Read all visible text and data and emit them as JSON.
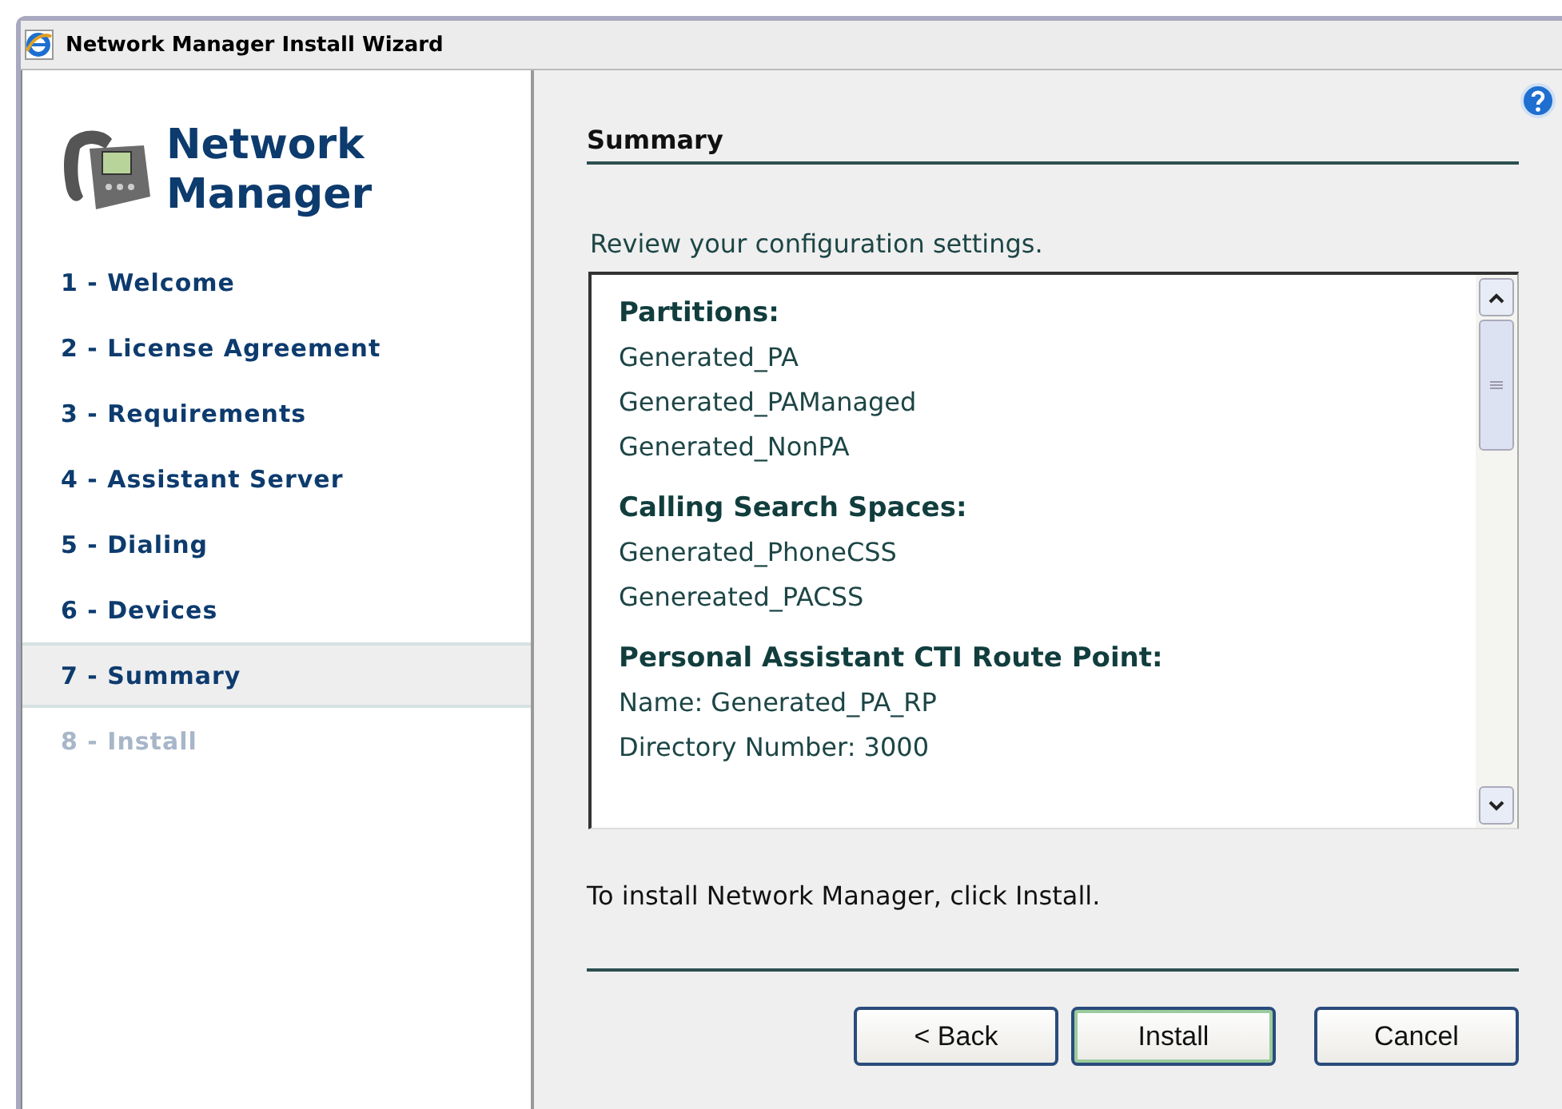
{
  "window": {
    "title": "Network Manager Install Wizard"
  },
  "logo": {
    "line_1": "Network",
    "line_2": "Manager"
  },
  "steps": [
    {
      "label": "1 - Welcome",
      "selected": false,
      "disabled": false
    },
    {
      "label": "2 - License Agreement",
      "selected": false,
      "disabled": false
    },
    {
      "label": "3 - Requirements",
      "selected": false,
      "disabled": false
    },
    {
      "label": "4 - Assistant Server",
      "selected": false,
      "disabled": false
    },
    {
      "label": "5 - Dialing",
      "selected": false,
      "disabled": false
    },
    {
      "label": "6 - Devices",
      "selected": false,
      "disabled": false
    },
    {
      "label": "7 - Summary",
      "selected": true,
      "disabled": false
    },
    {
      "label": "8 - Install",
      "selected": false,
      "disabled": true
    }
  ],
  "page": {
    "heading": "Summary",
    "intro": "Review your configuration settings.",
    "footer": "To install Network Manager, click Install."
  },
  "summary_sections": [
    {
      "heading": "Partitions:",
      "lines": [
        "Generated_PA",
        "Generated_PAManaged",
        "Generated_NonPA"
      ]
    },
    {
      "heading": "Calling Search Spaces:",
      "lines": [
        "Generated_PhoneCSS",
        "Genereated_PACSS"
      ]
    },
    {
      "heading": "Personal Assistant CTI Route Point:",
      "lines": [
        "Name: Generated_PA_RP",
        "Directory Number: 3000"
      ]
    }
  ],
  "buttons": [
    {
      "label": "< Back",
      "default": false
    },
    {
      "label": "Install",
      "default": true
    },
    {
      "label": "Cancel",
      "default": false
    }
  ]
}
